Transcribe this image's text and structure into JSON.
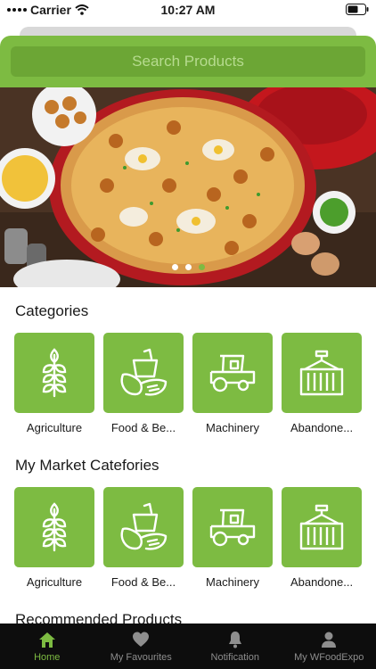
{
  "status_bar": {
    "carrier": "Carrier",
    "time": "10:27 AM"
  },
  "search": {
    "placeholder": "Search Products"
  },
  "banner": {
    "slide_count": 3,
    "active_slide": 3
  },
  "categories": {
    "title": "Categories",
    "items": [
      {
        "label": "Agriculture",
        "icon": "wheat-icon"
      },
      {
        "label": "Food & Be...",
        "icon": "food-beverage-icon"
      },
      {
        "label": "Machinery",
        "icon": "tractor-icon"
      },
      {
        "label": "Abandone...",
        "icon": "container-icon"
      }
    ]
  },
  "market_categories": {
    "title": "My Market Catefories",
    "items": [
      {
        "label": "Agriculture",
        "icon": "wheat-icon"
      },
      {
        "label": "Food & Be...",
        "icon": "food-beverage-icon"
      },
      {
        "label": "Machinery",
        "icon": "tractor-icon"
      },
      {
        "label": "Abandone...",
        "icon": "container-icon"
      }
    ]
  },
  "recommended": {
    "title": "Recommended Products"
  },
  "tabbar": {
    "items": [
      {
        "label": "Home",
        "icon": "home-icon",
        "active": true
      },
      {
        "label": "My Favourites",
        "icon": "heart-icon",
        "active": false
      },
      {
        "label": "Notification",
        "icon": "bell-icon",
        "active": false
      },
      {
        "label": "My WFoodExpo",
        "icon": "person-icon",
        "active": false
      }
    ]
  },
  "colors": {
    "accent": "#7dbb42",
    "accent_dark": "#6ca635",
    "tabbar_bg": "#0d0d0d",
    "inactive": "#8e8e8e"
  }
}
